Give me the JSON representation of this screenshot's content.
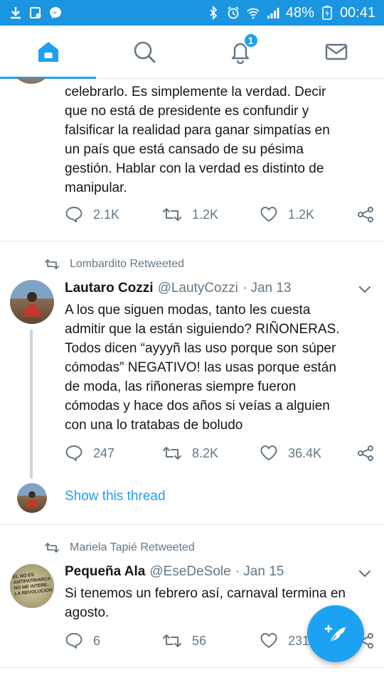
{
  "status_bar": {
    "battery": "48%",
    "time": "00:41"
  },
  "tabs": {
    "notifications_badge": "1"
  },
  "tweets": [
    {
      "text": "celebrarlo. Es simplemente la verdad. Decir\nque no está de presidente es confundir y\nfalsificar la realidad para ganar simpatías en\nun país que está cansado de su pésima\ngestión. Hablar con la verdad es distinto de\nmanipular.",
      "replies": "2.1K",
      "retweets": "1.2K",
      "likes": "1.2K"
    },
    {
      "retweeted_by": "Lombardito Retweeted",
      "name": "Lautaro Cozzi",
      "handle": "@LautyCozzi",
      "date": "· Jan 13",
      "text": "A los que siguen modas, tanto les cuesta\nadmitir que la están siguiendo? RIÑONERAS.\nTodos dicen “ayyyñ las uso porque son súper\ncómodas” NEGATIVO! las usas porque están\nde moda, las riñoneras siempre fueron\ncómodas y hace dos años si veías a alguien\ncon una lo tratabas de boludo",
      "replies": "247",
      "retweets": "8.2K",
      "likes": "36.4K",
      "show_thread": "Show this thread"
    },
    {
      "retweeted_by": "Mariela Tapié Retweeted",
      "name": "Pequeña Ala",
      "handle": "@EseDeSole",
      "date": "· Jan 15",
      "text": "Si tenemos un febrero así, carnaval termina en\nagosto.",
      "replies": "6",
      "retweets": "56",
      "likes": "231",
      "avatar_text": "EL NO ES\nANTIPATRIARCA\nNO ME INTERE..\nLA REVOLUCION"
    }
  ],
  "colors": {
    "status_bar": "#1b95e0",
    "accent": "#1da1f2",
    "muted": "#657786"
  }
}
